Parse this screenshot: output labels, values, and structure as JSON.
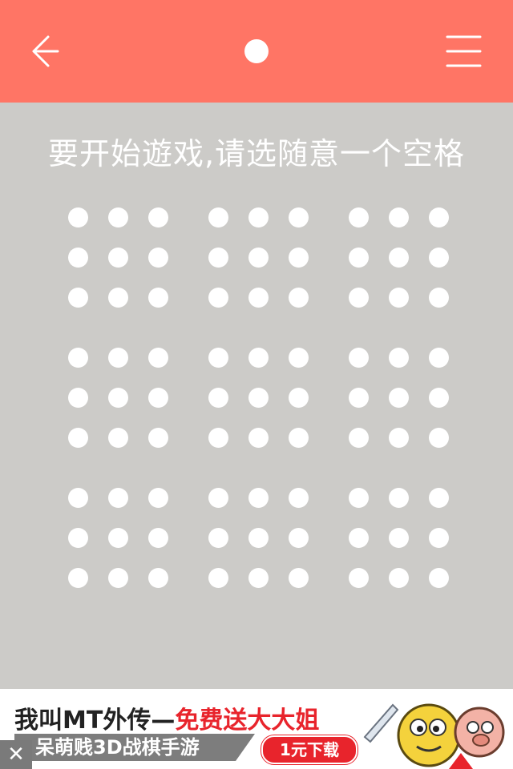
{
  "header": {
    "back_icon": "arrow-left-icon",
    "center_icon": "dot-icon",
    "menu_icon": "hamburger-menu-icon",
    "background_color": "#ff7565"
  },
  "prompt": {
    "text": "要开始遊戏,请选随意一个空格"
  },
  "board": {
    "blocks": 3,
    "cells_per_block": 3,
    "cell_color": "#ffffff",
    "background_color": "#cccbc8"
  },
  "ad": {
    "line1_part1": "我叫MT外传—",
    "line1_part2": "免费送大大姐",
    "line2": "呆萌贱3D战棋手游",
    "cta": "1元下载",
    "close_icon": "close-icon",
    "accent_color": "#e8242c"
  }
}
